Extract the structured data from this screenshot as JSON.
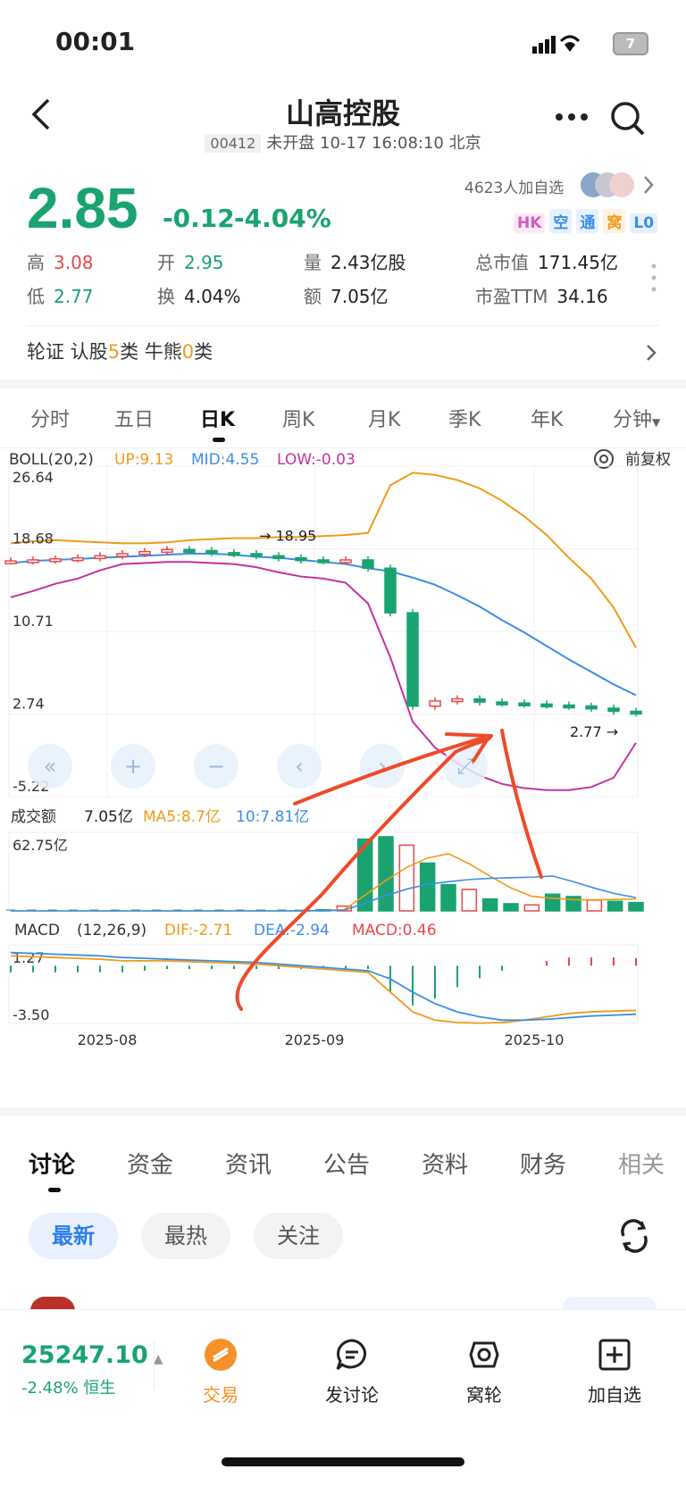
{
  "status": {
    "time": "00:01",
    "battery": "7"
  },
  "header": {
    "title": "山高控股",
    "code": "00412",
    "status_text": "未开盘 10-17 16:08:10 北京"
  },
  "quote": {
    "price": "2.85",
    "change": "-0.12",
    "change_pct": "-4.04%",
    "follow_text": "4623人加自选",
    "badges": [
      "HK",
      "空",
      "通",
      "窝",
      "L0"
    ],
    "stats": {
      "high_label": "高",
      "high": "3.08",
      "low_label": "低",
      "low": "2.77",
      "open_label": "开",
      "open": "2.95",
      "turnover_label": "换",
      "turnover": "4.04%",
      "volume_label": "量",
      "volume": "2.43亿股",
      "amount_label": "额",
      "amount": "7.05亿",
      "mktcap_label": "总市值",
      "mktcap": "171.45亿",
      "pe_label": "市盈TTM",
      "pe": "34.16"
    },
    "warrant": {
      "prefix": "轮证  认股",
      "call_count": "5",
      "call_suffix": "类  牛熊",
      "cbbc_count": "0",
      "cbbc_suffix": "类"
    }
  },
  "chart_tabs": [
    "分时",
    "五日",
    "日K",
    "周K",
    "月K",
    "季K",
    "年K",
    "分钟"
  ],
  "active_chart_tab": "日K",
  "chart_data": {
    "type": "line",
    "title": "",
    "boll": {
      "label": "BOLL(20,2)",
      "up_label": "UP:9.13",
      "mid_label": "MID:4.55",
      "low_label": "LOW:-0.03",
      "adjust_label": "前复权",
      "y_ticks": [
        "26.64",
        "18.68",
        "10.71",
        "2.74",
        "-5.22"
      ],
      "max_note": "18.95",
      "min_note": "2.77",
      "ylim": [
        -5.22,
        26.64
      ]
    },
    "volume": {
      "label": "成交额",
      "value": "7.05亿",
      "ma5": "MA5:8.7亿",
      "ma10": "10:7.81亿",
      "y_max_label": "62.75亿",
      "ylim": [
        0,
        62.75
      ]
    },
    "macd": {
      "label": "MACD",
      "params": "(12,26,9)",
      "dif": "DIF:-2.71",
      "dea": "DEA:-2.94",
      "macd": "MACD:0.46",
      "y_ticks": [
        "1.27",
        "-3.50"
      ]
    },
    "x_ticks": [
      "2025-08",
      "2025-09",
      "2025-10"
    ],
    "series": [
      {
        "name": "UP",
        "values": [
          19.2,
          19.4,
          19.5,
          19.4,
          19.3,
          19.2,
          19.2,
          19.3,
          19.5,
          19.6,
          19.7,
          19.7,
          19.8,
          19.8,
          19.9,
          20.0,
          20.2,
          24.8,
          26.0,
          25.8,
          25.3,
          24.5,
          23.3,
          21.8,
          20.0,
          17.8,
          15.8,
          13.0,
          9.13
        ]
      },
      {
        "name": "MID",
        "values": [
          17.3,
          17.5,
          17.6,
          17.7,
          17.8,
          17.9,
          18.0,
          18.1,
          18.2,
          18.2,
          18.1,
          17.9,
          17.8,
          17.6,
          17.4,
          17.2,
          16.8,
          16.5,
          15.9,
          15.2,
          14.2,
          13.1,
          11.8,
          10.6,
          9.3,
          8.0,
          6.8,
          5.6,
          4.55
        ]
      },
      {
        "name": "LOW",
        "values": [
          14.0,
          14.6,
          15.3,
          15.8,
          16.6,
          17.2,
          17.3,
          17.4,
          17.4,
          17.3,
          17.2,
          16.9,
          16.4,
          16.0,
          15.8,
          15.4,
          13.4,
          8.2,
          2.0,
          -0.5,
          -2.0,
          -3.2,
          -4.0,
          -4.4,
          -4.6,
          -4.6,
          -4.3,
          -3.4,
          -0.03
        ]
      },
      {
        "name": "Close",
        "values": [
          17.5,
          17.6,
          17.7,
          17.8,
          18.0,
          18.2,
          18.4,
          18.6,
          18.5,
          18.3,
          18.2,
          18.0,
          17.8,
          17.6,
          17.5,
          17.6,
          16.8,
          12.5,
          3.5,
          4.0,
          4.2,
          3.9,
          3.8,
          3.7,
          3.6,
          3.5,
          3.3,
          3.0,
          2.85
        ]
      }
    ],
    "volume_bars": [
      0,
      0,
      0,
      0,
      0,
      0,
      0,
      0,
      0,
      0,
      0,
      0,
      0,
      0,
      0.5,
      1,
      4,
      60,
      62,
      55,
      40,
      22,
      18,
      10,
      6,
      5,
      14,
      12,
      9,
      8,
      7
    ]
  },
  "discussion_tabs": [
    "讨论",
    "资金",
    "资讯",
    "公告",
    "资料",
    "财务",
    "相关"
  ],
  "filters": [
    "最新",
    "最热",
    "关注"
  ],
  "bottom": {
    "index_value": "25247.10",
    "index_change": "-2.48%",
    "index_name": "恒生",
    "items": [
      "交易",
      "发讨论",
      "窝轮",
      "加自选"
    ]
  }
}
